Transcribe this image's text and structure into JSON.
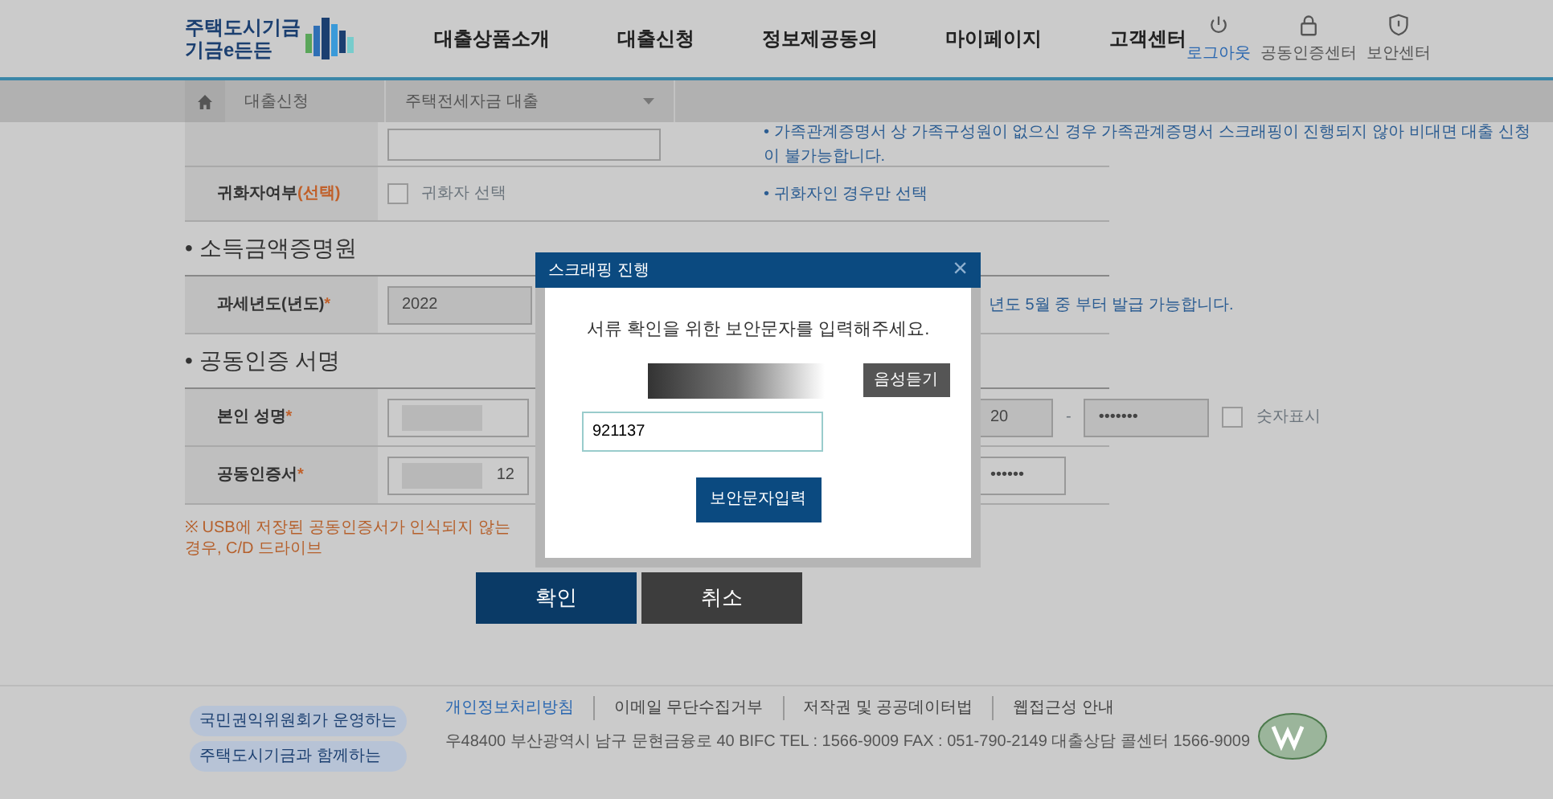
{
  "header": {
    "logo": {
      "line1": "주택도시기금",
      "line2": "기금e든든"
    },
    "nav": [
      "대출상품소개",
      "대출신청",
      "정보제공동의",
      "마이페이지",
      "고객센터"
    ],
    "utilities": [
      {
        "label": "로그아웃",
        "highlighted": true
      },
      {
        "label": "공동인증센터",
        "highlighted": false
      },
      {
        "label": "보안센터",
        "highlighted": false
      }
    ]
  },
  "breadcrumb": {
    "item": "대출신청",
    "select": "주택전세자금 대출"
  },
  "sections": [
    {
      "rows": [
        {
          "kind": "input",
          "note": "• 가족관계증명서 상 가족구성원이 없으신 경우 가족관계증명서 스크래핑이 진행되지 않아 비대면 대출 신청이 불가능합니다."
        },
        {
          "kind": "checkbox",
          "label": "귀화자여부",
          "label_suffix": "(선택)",
          "checked": false,
          "option": "귀화자 선택",
          "note": "• 귀화자인 경우만 선택"
        }
      ]
    },
    {
      "title": "• 소득금액증명원",
      "rows": [
        {
          "kind": "readonly",
          "label": "과세년도(년도)",
          "mark": "*",
          "value": "2022",
          "note": "년도 5월 중 부터 발급 가능합니다."
        }
      ]
    },
    {
      "title": "• 공동인증 서명",
      "rows": [
        {
          "kind": "resident",
          "label": "본인 성명",
          "mark": "*",
          "value_end": "20",
          "separator": "-",
          "masked": "•••••••",
          "toggle": {
            "label": "숫자표시",
            "checked": false
          }
        },
        {
          "kind": "cert",
          "label": "공동인증서",
          "mark": "*",
          "value_end": "12",
          "masked": "••••••"
        }
      ]
    }
  ],
  "warning": "※ USB에 저장된 공동인증서가 인식되지 않는 경우, C/D 드라이브",
  "buttons": [
    {
      "label": "확인",
      "kind": "primary"
    },
    {
      "label": "취소",
      "kind": "secondary"
    }
  ],
  "footer": {
    "badges": [
      "국민권익위원회가 운영하는",
      "주택도시기금과 함께하는"
    ],
    "links": [
      {
        "label": "개인정보처리방침",
        "highlighted": true
      },
      {
        "label": "이메일 무단수집거부",
        "highlighted": false
      },
      {
        "label": "저작권 및 공공데이터법",
        "highlighted": false
      },
      {
        "label": "웹접근성 안내",
        "highlighted": false
      }
    ],
    "address": "우48400 부산광역시 남구 문현금융로 40 BIFC   TEL : 1566-9009   FAX : 051-790-2149   대출상담 콜센터 1566-9009"
  },
  "modal": {
    "title": "스크래핑 진행",
    "close": "×",
    "message": "서류 확인을 위한 보안문자를 입력해주세요.",
    "audio_button": "음성듣기",
    "input_value": "921137",
    "submit": "보안문자입력"
  }
}
